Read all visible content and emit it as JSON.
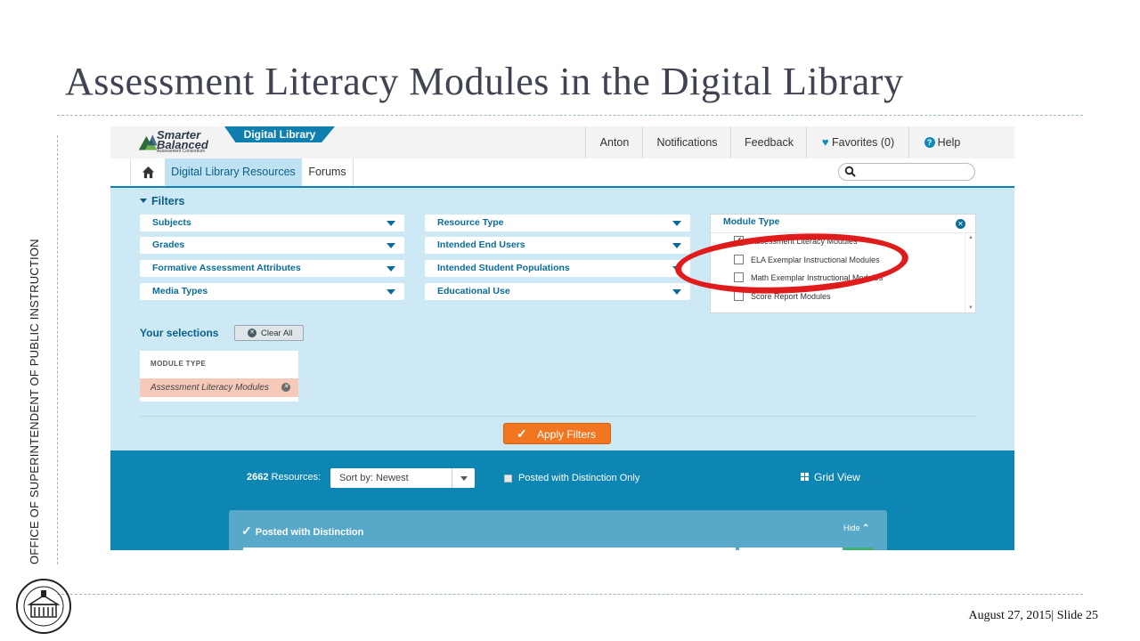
{
  "slide": {
    "title": "Assessment Literacy Modules in the Digital Library",
    "side_text": "OFFICE OF SUPERINTENDENT OF PUBLIC INSTRUCTION",
    "footer": "August 27, 2015|   Slide 25"
  },
  "header": {
    "logo_line1": "Smarter",
    "logo_line2": "Balanced",
    "logo_sub": "Assessment Consortium",
    "app_tab": "Digital Library",
    "nav": [
      {
        "label": "Anton"
      },
      {
        "label": "Notifications"
      },
      {
        "label": "Feedback"
      },
      {
        "label": "Favorites (0)"
      },
      {
        "label": "Help"
      }
    ]
  },
  "subnav": {
    "tabs": [
      {
        "label": "Digital Library Resources",
        "active": true
      },
      {
        "label": "Forums",
        "active": false
      }
    ],
    "search_value": ""
  },
  "filters": {
    "heading": "Filters",
    "dropdowns": [
      {
        "label": "Subjects"
      },
      {
        "label": "Grades"
      },
      {
        "label": "Formative Assessment Attributes"
      },
      {
        "label": "Media Types"
      },
      {
        "label": "Resource Type"
      },
      {
        "label": "Intended End Users"
      },
      {
        "label": "Intended Student Populations"
      },
      {
        "label": "Educational Use"
      }
    ],
    "module_type": {
      "label": "Module Type",
      "options": [
        {
          "label": "Assessment Literacy Modules",
          "checked": true
        },
        {
          "label": "ELA Exemplar Instructional Modules",
          "checked": false
        },
        {
          "label": "Math Exemplar Instructional Modules",
          "checked": false
        },
        {
          "label": "Score Report Modules",
          "checked": false
        }
      ]
    }
  },
  "selections": {
    "heading": "Your selections",
    "clear_label": "Clear All",
    "group_label": "MODULE TYPE",
    "items": [
      {
        "label": "Assessment Literacy Modules"
      }
    ]
  },
  "apply_label": "Apply Filters",
  "results": {
    "count": "2662",
    "count_suffix": "Resources:",
    "sort_value": "Sort by: Newest",
    "distinction_only_label": "Posted with Distinction Only",
    "grid_view_label": "Grid View",
    "panel_title": "Posted with Distinction",
    "hide_label": "Hide"
  },
  "colors": {
    "brand": "#0f7fb0",
    "panel_bg": "#cce9f5",
    "apply": "#f27620",
    "highlight": "#e01b1b",
    "chip": "#f6c9b8"
  }
}
